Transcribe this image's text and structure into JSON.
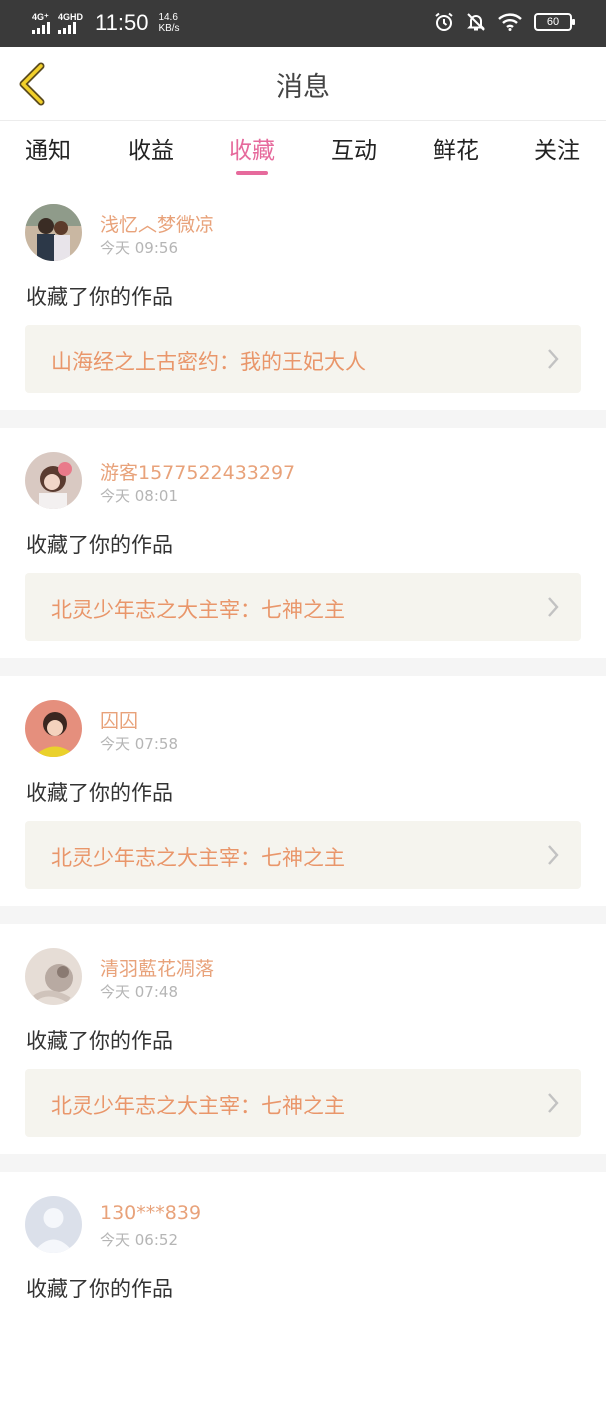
{
  "status_bar": {
    "signal1_label": "4G⁺",
    "signal2_label": "4GHD",
    "time": "11:50",
    "speed_value": "14.6",
    "speed_unit": "KB/s",
    "battery": "60"
  },
  "header": {
    "title": "消息"
  },
  "tabs": [
    {
      "label": "通知"
    },
    {
      "label": "收益"
    },
    {
      "label": "收藏"
    },
    {
      "label": "互动"
    },
    {
      "label": "鲜花"
    },
    {
      "label": "关注"
    }
  ],
  "active_tab": "收藏",
  "colors": {
    "accent": "#e66a9c",
    "username": "#e8a27a",
    "work_title": "#e9966a",
    "work_bg": "#f5f4ee"
  },
  "messages": [
    {
      "username": "浅忆︿梦微凉",
      "time": "今天 09:56",
      "text": "收藏了你的作品",
      "work_title": "山海经之上古密约：我的王妃大人"
    },
    {
      "username": "游客1577522433297",
      "time": "今天 08:01",
      "text": "收藏了你的作品",
      "work_title": "北灵少年志之大主宰：七神之主"
    },
    {
      "username": "囚囚",
      "time": "今天 07:58",
      "text": "收藏了你的作品",
      "work_title": "北灵少年志之大主宰：七神之主"
    },
    {
      "username": "清羽藍花凋落",
      "time": "今天 07:48",
      "text": "收藏了你的作品",
      "work_title": "北灵少年志之大主宰：七神之主"
    },
    {
      "username": "130***839",
      "time": "今天 06:52",
      "text": "收藏了你的作品"
    }
  ]
}
